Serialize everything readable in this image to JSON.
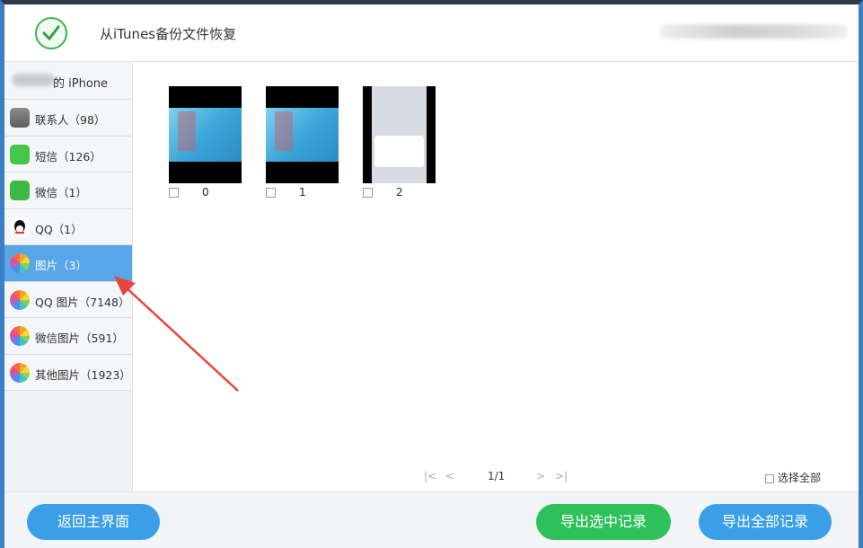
{
  "header": {
    "title": "从iTunes备份文件恢复"
  },
  "sidebar": {
    "device_label": "的 iPhone",
    "items": [
      {
        "label": "联系人（98）",
        "icon": "contacts-icon",
        "active": false
      },
      {
        "label": "短信（126）",
        "icon": "sms-icon",
        "active": false
      },
      {
        "label": "微信（1）",
        "icon": "wechat-icon",
        "active": false
      },
      {
        "label": "QQ（1）",
        "icon": "qq-icon",
        "active": false
      },
      {
        "label": "图片（3）",
        "icon": "photos-icon",
        "active": true
      },
      {
        "label": "QQ 图片（7148）",
        "icon": "qq-photos-icon",
        "active": false
      },
      {
        "label": "微信图片（591）",
        "icon": "wechat-photos-icon",
        "active": false
      },
      {
        "label": "其他图片（1923）",
        "icon": "other-photos-icon",
        "active": false
      }
    ]
  },
  "photos": [
    {
      "index": "0",
      "checked": false
    },
    {
      "index": "1",
      "checked": false
    },
    {
      "index": "2",
      "checked": false
    }
  ],
  "pager": {
    "page": "1/1"
  },
  "select_all_label": "选择全部",
  "footer": {
    "back_label": "返回主界面",
    "export_selected_label": "导出选中记录",
    "export_all_label": "导出全部记录"
  },
  "colors": {
    "accent_blue": "#3a9fe6",
    "active_item": "#56a6e9",
    "export_green": "#2ec15a",
    "annotation_arrow": "#e8453c"
  }
}
